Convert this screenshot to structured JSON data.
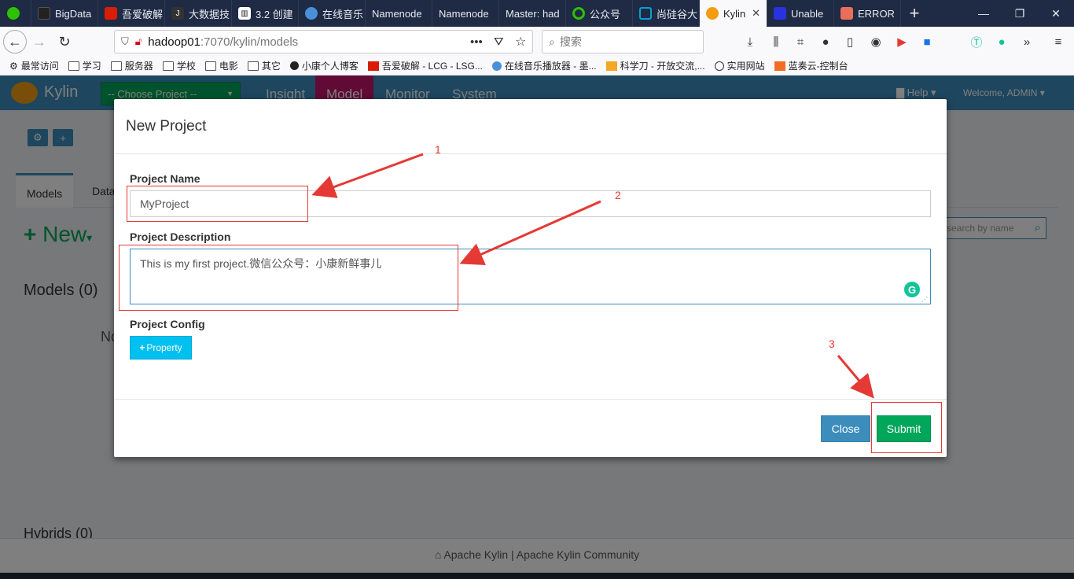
{
  "browser": {
    "tabs": [
      {
        "label": "",
        "icon": "wechat-icon",
        "color": "#2dc100"
      },
      {
        "label": "BigData",
        "icon": "bigdata-icon",
        "color": "#222222"
      },
      {
        "label": "吾爱破解",
        "icon": "52pojie-icon",
        "color": "#d81e06"
      },
      {
        "label": "大数据技",
        "icon": "csdn-icon",
        "color": "#333333"
      },
      {
        "label": "3.2 创建",
        "icon": "book-icon",
        "color": "#ffffff"
      },
      {
        "label": "在线音乐",
        "icon": "globe-icon",
        "color": "#4a90d9"
      },
      {
        "label": "Namenode",
        "icon": "",
        "color": ""
      },
      {
        "label": "Namenode",
        "icon": "",
        "color": ""
      },
      {
        "label": "Master: had",
        "icon": "",
        "color": ""
      },
      {
        "label": "公众号",
        "icon": "wechat-mp-icon",
        "color": "#2dc100"
      },
      {
        "label": "尚硅谷大",
        "icon": "bilibili-icon",
        "color": "#00a1d6"
      },
      {
        "label": "Kylin",
        "icon": "kylin-icon",
        "color": "#f39c12"
      },
      {
        "label": "Unable",
        "icon": "baidu-icon",
        "color": "#2932e1"
      },
      {
        "label": "ERROR",
        "icon": "jianshu-icon",
        "color": "#ea6f5a"
      }
    ],
    "url_host": "hadoop01",
    "url_rest": ":7070/kylin/models",
    "search_placeholder": "搜索",
    "bookmarks": [
      {
        "label": "最常访问",
        "icon": "gear-icon"
      },
      {
        "label": "学习",
        "icon": "folder-icon"
      },
      {
        "label": "服务器",
        "icon": "folder-icon"
      },
      {
        "label": "学校",
        "icon": "folder-icon"
      },
      {
        "label": "电影",
        "icon": "folder-icon"
      },
      {
        "label": "其它",
        "icon": "folder-icon"
      },
      {
        "label": "小康个人博客",
        "icon": "blog-icon"
      },
      {
        "label": "吾爱破解 - LCG - LSG...",
        "icon": "52pojie-icon"
      },
      {
        "label": "在线音乐播放器 - 墨...",
        "icon": "globe-icon"
      },
      {
        "label": "科学刀 - 开放交流,...",
        "icon": "kxdao-icon"
      },
      {
        "label": "实用网站",
        "icon": "globe-icon"
      },
      {
        "label": "蓝奏云-控制台",
        "icon": "lanzou-icon"
      }
    ]
  },
  "kylin": {
    "brand": "Kylin",
    "project_select": "-- Choose Project --",
    "nav": [
      "Insight",
      "Model",
      "Monitor",
      "System"
    ],
    "help": "Help",
    "welcome": "Welcome, ADMIN",
    "page_tabs": [
      "Models",
      "Data"
    ],
    "new_label": "New",
    "search_placeholder": "search by name",
    "models_title": "Models (0)",
    "hybrids_title": "Hybrids (0)",
    "no_text": "No",
    "footer": "Apache Kylin | Apache Kylin Community"
  },
  "modal": {
    "title": "New Project",
    "project_name_label": "Project Name",
    "project_name_value": "MyProject",
    "project_description_label": "Project Description",
    "project_description_value": "This is my first project.微信公众号：小康新鲜事儿",
    "project_config_label": "Project Config",
    "property_button": "Property",
    "close_button": "Close",
    "submit_button": "Submit"
  },
  "annotations": [
    "1",
    "2",
    "3"
  ],
  "colors": {
    "header": "#3c8dbc",
    "model_active": "#c0146b",
    "project_select": "#00a65a",
    "submit": "#00a65a",
    "close": "#3c8dbc",
    "property": "#00c0ef",
    "annotation": "#e53935"
  }
}
